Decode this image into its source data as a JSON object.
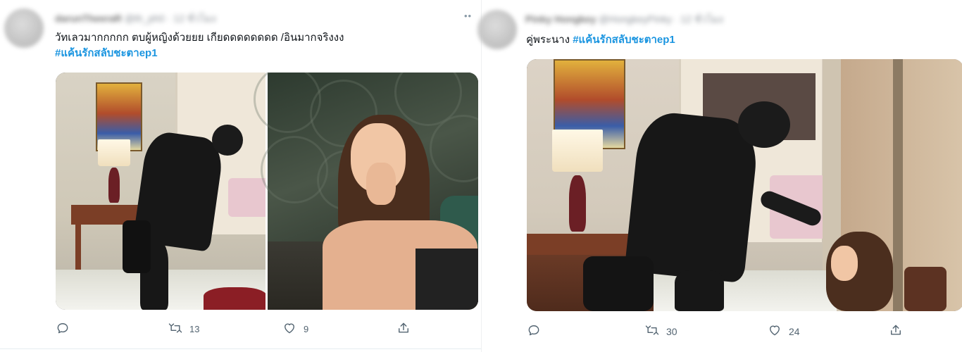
{
  "tweets": [
    {
      "author_name": "darunTheeraR",
      "author_handle": "@th_ph0 · 12 ชั่วโมง",
      "text": "วัทเลวมากกกกก ตบผู้หญิงด้วยยย เกียดดดดดดดด /อินมากจริงงง",
      "hashtag": "#แค้นรักสลับชะตาep1",
      "replies": "",
      "retweets": "13",
      "likes": "9"
    },
    {
      "author_name": "Pinky Hongkey",
      "author_handle": "@HongkeyPinky · 12 ชั่วโมง",
      "text": "คู่พระนาง ",
      "hashtag": "#แค้นรักสลับชะตาep1",
      "replies": "",
      "retweets": "30",
      "likes": "24"
    }
  ],
  "icons": {
    "reply": "reply-icon",
    "retweet": "retweet-icon",
    "like": "heart-icon",
    "share": "share-icon",
    "more": "more-icon"
  },
  "colors": {
    "hashtag": "#1b95e0",
    "action": "#536471",
    "text": "#0f1419"
  }
}
